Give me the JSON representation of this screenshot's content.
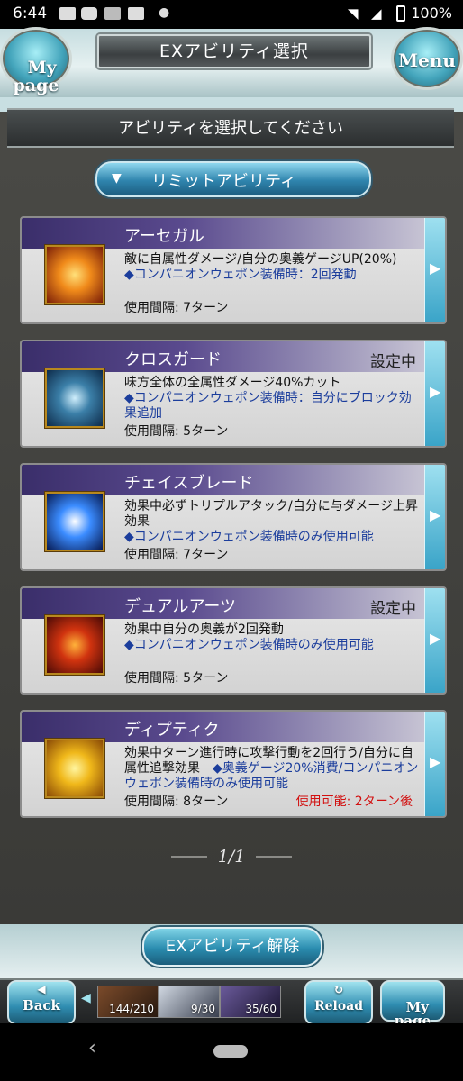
{
  "status_bar": {
    "time": "6:44",
    "battery": "100%"
  },
  "header": {
    "title": "EXアビリティ選択",
    "mypage_label": "My\npage",
    "menu_label": "Menu"
  },
  "instruction": "アビリティを選択してください",
  "section_tab": {
    "label": "リミットアビリティ"
  },
  "abilities": [
    {
      "name": "アーセガル",
      "setting": "",
      "desc_main": "敵に自属性ダメージ/自分の奥義ゲージUP(20%)",
      "desc_blue": "◆コンパニオンウェポン装備時：2回発動",
      "desc_tail": "",
      "interval": "使用間隔: 7ターン",
      "cooldown": "",
      "icon_name": "sparkle-burst-icon",
      "icon_colors": [
        "#ffe07a",
        "#f08a1a",
        "#7a1e08"
      ]
    },
    {
      "name": "クロスガード",
      "setting": "設定中",
      "desc_main": "味方全体の全属性ダメージ40%カット",
      "desc_blue": "◆コンパニオンウェポン装備時：自分にブロック効果追加",
      "desc_tail": "",
      "interval": "使用間隔: 5ターン",
      "cooldown": "",
      "icon_name": "knight-guard-icon",
      "icon_colors": [
        "#cfeefc",
        "#3b7fa8",
        "#0d2b4a"
      ]
    },
    {
      "name": "チェイスブレード",
      "setting": "",
      "desc_main": "効果中必ずトリプルアタック/自分に与ダメージ上昇効果",
      "desc_blue": "◆コンパニオンウェポン装備時のみ使用可能",
      "desc_tail": "",
      "interval": "使用間隔: 7ターン",
      "cooldown": "",
      "icon_name": "blue-flash-icon",
      "icon_colors": [
        "#ffffff",
        "#3b8cff",
        "#071a52"
      ]
    },
    {
      "name": "デュアルアーツ",
      "setting": "設定中",
      "desc_main": "効果中自分の奥義が2回発動",
      "desc_blue": "◆コンパニオンウェポン装備時のみ使用可能",
      "desc_tail": "",
      "interval": "使用間隔: 5ターン",
      "cooldown": "",
      "icon_name": "crossed-swords-icon",
      "icon_colors": [
        "#ffb23a",
        "#d0330f",
        "#4a0a06"
      ]
    },
    {
      "name": "ディプティク",
      "setting": "",
      "desc_main": "効果中ターン進行時に攻撃行動を2回行う/自分に自属性追撃効果　",
      "desc_blue": "◆奥義ゲージ20%消費/コンパニオンウェポン装備時のみ使用可能",
      "desc_tail": "",
      "interval": "使用間隔: 8ターン",
      "cooldown": "使用可能: 2ターン後",
      "icon_name": "golden-strike-icon",
      "icon_colors": [
        "#fff5a0",
        "#f0b81a",
        "#8a4a06"
      ]
    }
  ],
  "pager": "1/1",
  "release_button": "EXアビリティ解除",
  "footer": {
    "back_label": "Back",
    "reload_label": "Reload",
    "mypage_label": "My\npage",
    "stats": [
      {
        "value": "144/210",
        "icon": "ap-icon"
      },
      {
        "value": "9/30",
        "icon": "bp-icon"
      },
      {
        "value": "35/60",
        "icon": "ep-icon"
      }
    ]
  },
  "colors": {
    "accent": "#2f84ad",
    "setting": "#222222",
    "cooldown": "#d21010",
    "desc_blue": "#1b3d9c"
  }
}
